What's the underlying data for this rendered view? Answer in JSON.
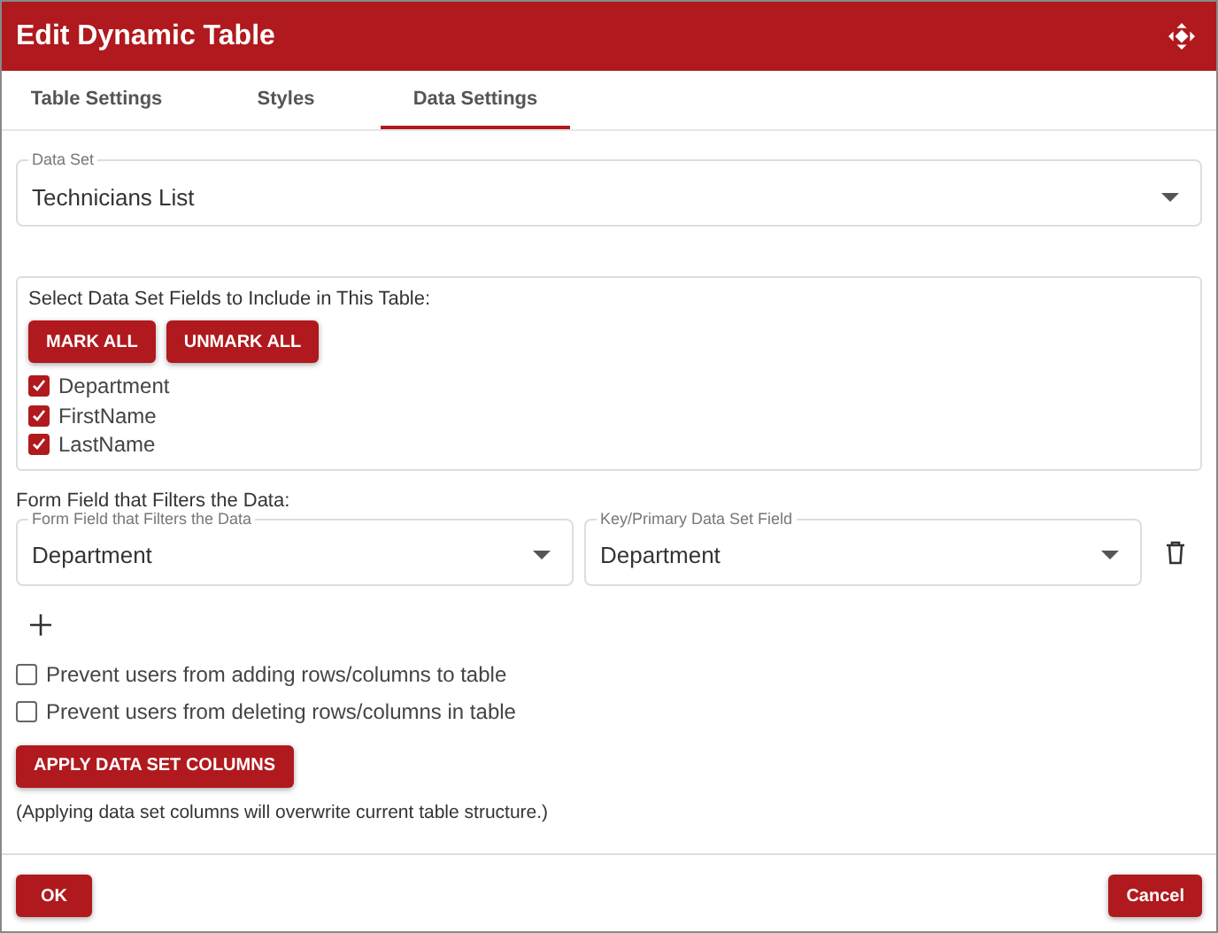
{
  "window": {
    "title": "Edit Dynamic Table"
  },
  "tabs": [
    {
      "label": "Table Settings",
      "selected": false
    },
    {
      "label": "Styles",
      "selected": false
    },
    {
      "label": "Data Settings",
      "selected": true
    }
  ],
  "data_set": {
    "label": "Data Set",
    "value": "Technicians List"
  },
  "fields_box": {
    "title": "Select Data Set Fields to Include in This Table:",
    "buttons": [
      "MARK ALL",
      "UNMARK ALL"
    ],
    "fields": [
      {
        "label": "Department",
        "checked": true
      },
      {
        "label": "FirstName",
        "checked": true
      },
      {
        "label": "LastName",
        "checked": true
      }
    ]
  },
  "filter": {
    "title": "Form Field that Filters the Data:",
    "form_field": {
      "label": "Form Field that Filters the Data",
      "value": "Department"
    },
    "key_field": {
      "label": "Key/Primary Data Set Field",
      "value": "Department"
    }
  },
  "options": [
    {
      "label": "Prevent users from adding rows/columns to table",
      "checked": false
    },
    {
      "label": "Prevent users from deleting rows/columns in table",
      "checked": false
    }
  ],
  "apply_button": "APPLY DATA SET COLUMNS",
  "note": "(Applying data set columns will overwrite current table structure.)",
  "footer": {
    "ok": "OK",
    "cancel": "Cancel"
  }
}
